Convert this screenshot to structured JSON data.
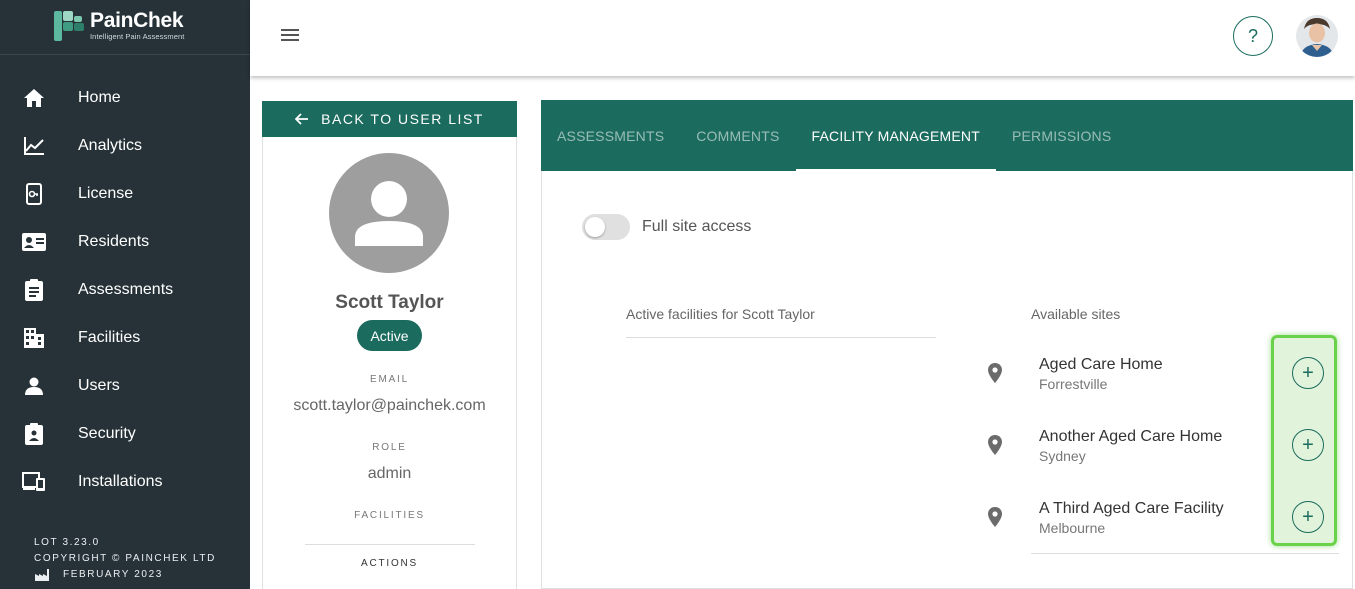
{
  "app": {
    "logo_name": "PainChek",
    "logo_tagline": "Intelligent Pain Assessment"
  },
  "sidebar": {
    "items": [
      {
        "label": "Home",
        "icon": "home-icon"
      },
      {
        "label": "Analytics",
        "icon": "analytics-icon"
      },
      {
        "label": "License",
        "icon": "license-icon"
      },
      {
        "label": "Residents",
        "icon": "residents-icon"
      },
      {
        "label": "Assessments",
        "icon": "assessments-icon"
      },
      {
        "label": "Facilities",
        "icon": "facilities-icon"
      },
      {
        "label": "Users",
        "icon": "users-icon"
      },
      {
        "label": "Security",
        "icon": "security-icon"
      },
      {
        "label": "Installations",
        "icon": "installations-icon"
      }
    ],
    "footer": {
      "version": "LOT 3.23.0",
      "copyright": "COPYRIGHT © PAINCHEK LTD",
      "date": "FEBRUARY 2023"
    }
  },
  "topbar": {
    "help_label": "?"
  },
  "profile": {
    "back_label": "BACK TO USER LIST",
    "name": "Scott Taylor",
    "status": "Active",
    "email_label": "EMAIL",
    "email": "scott.taylor@painchek.com",
    "role_label": "ROLE",
    "role": "admin",
    "facilities_label": "FACILITIES",
    "actions_label": "ACTIONS"
  },
  "tabs": [
    {
      "label": "ASSESSMENTS",
      "active": false
    },
    {
      "label": "COMMENTS",
      "active": false
    },
    {
      "label": "FACILITY MANAGEMENT",
      "active": true
    },
    {
      "label": "PERMISSIONS",
      "active": false
    }
  ],
  "facility_management": {
    "full_access_label": "Full site access",
    "full_access_on": false,
    "active_header": "Active facilities for Scott Taylor",
    "available_header": "Available sites",
    "sites": [
      {
        "name": "Aged Care Home",
        "city": "Forrestville"
      },
      {
        "name": "Another Aged Care Home",
        "city": "Sydney"
      },
      {
        "name": "A Third Aged Care Facility",
        "city": "Melbourne"
      }
    ],
    "add_label": "+"
  },
  "colors": {
    "brand": "#1b6b5e",
    "sidebar": "#263238",
    "highlight": "#6ad24a"
  }
}
